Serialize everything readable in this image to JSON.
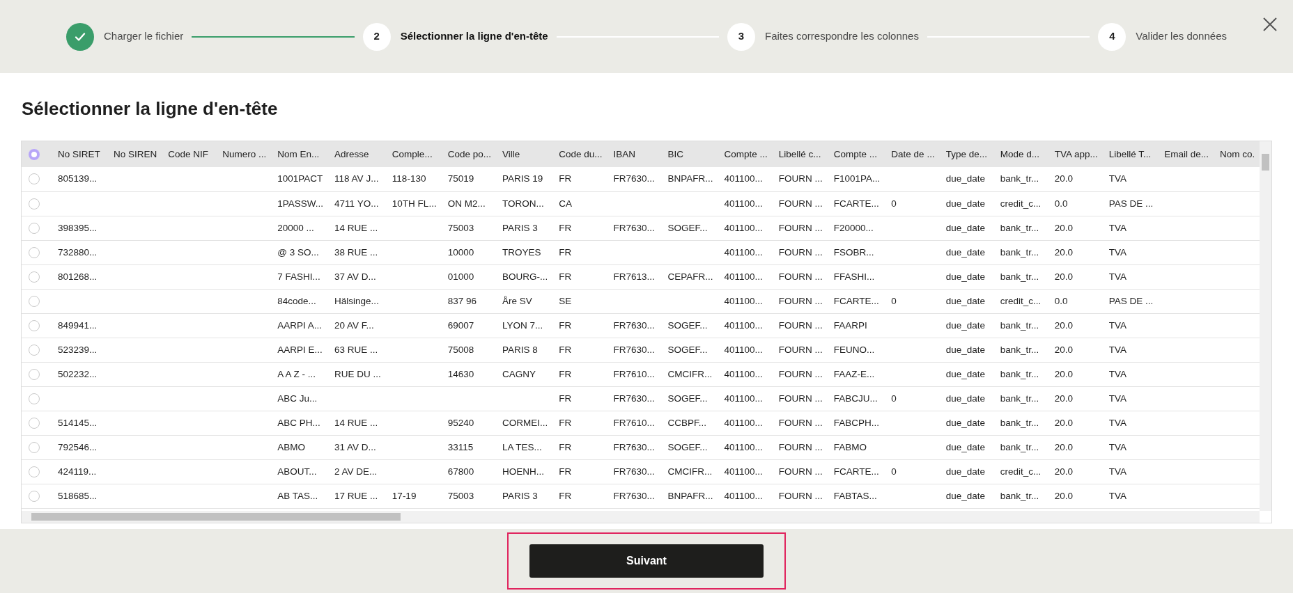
{
  "steps": [
    {
      "label": "Charger le fichier",
      "completed": true,
      "current": false
    },
    {
      "number": "2",
      "label": "Sélectionner la ligne d'en-tête",
      "completed": false,
      "current": true
    },
    {
      "number": "3",
      "label": "Faites correspondre les colonnes",
      "completed": false,
      "current": false
    },
    {
      "number": "4",
      "label": "Valider les données",
      "completed": false,
      "current": false
    }
  ],
  "title": "Sélectionner la ligne d'en-tête",
  "table": {
    "header_selected": true,
    "columns": [
      "No SIRET",
      "No SIREN",
      "Code NIF",
      "Numero ...",
      "Nom En...",
      "Adresse",
      "Comple...",
      "Code po...",
      "Ville",
      "Code du...",
      "IBAN",
      "BIC",
      "Compte ...",
      "Libellé c...",
      "Compte ...",
      "Date de ...",
      "Type de...",
      "Mode d...",
      "TVA app...",
      "Libellé T...",
      "Email de...",
      "Nom co."
    ],
    "rows": [
      {
        "selected": false,
        "cells": [
          "805139...",
          null,
          null,
          null,
          "1001PACT",
          "118 AV J...",
          "118-130",
          "75019",
          "PARIS 19",
          "FR",
          "FR7630...",
          "BNPAFR...",
          "401100...",
          "FOURN ...",
          "F1001PA...",
          null,
          "due_date",
          "bank_tr...",
          "20.0",
          "TVA",
          null,
          null
        ]
      },
      {
        "selected": false,
        "cells": [
          null,
          null,
          null,
          null,
          "1PASSW...",
          "4711 YO...",
          "10TH FL...",
          "ON M2...",
          "TORON...",
          "CA",
          null,
          null,
          "401100...",
          "FOURN ...",
          "FCARTE...",
          "0",
          "due_date",
          "credit_c...",
          "0.0",
          "PAS DE ...",
          null,
          null
        ]
      },
      {
        "selected": false,
        "cells": [
          "398395...",
          null,
          null,
          null,
          "20000 ...",
          "14 RUE ...",
          null,
          "75003",
          "PARIS 3",
          "FR",
          "FR7630...",
          "SOGEF...",
          "401100...",
          "FOURN ...",
          "F20000...",
          null,
          "due_date",
          "bank_tr...",
          "20.0",
          "TVA",
          null,
          null
        ]
      },
      {
        "selected": false,
        "cells": [
          "732880...",
          null,
          null,
          null,
          "@ 3 SO...",
          "38 RUE ...",
          null,
          "10000",
          "TROYES",
          "FR",
          null,
          null,
          "401100...",
          "FOURN ...",
          "FSOBR...",
          null,
          "due_date",
          "bank_tr...",
          "20.0",
          "TVA",
          null,
          null
        ]
      },
      {
        "selected": false,
        "cells": [
          "801268...",
          null,
          null,
          null,
          "7 FASHI...",
          "37 AV D...",
          null,
          "01000",
          "BOURG-...",
          "FR",
          "FR7613...",
          "CEPAFR...",
          "401100...",
          "FOURN ...",
          "FFASHI...",
          null,
          "due_date",
          "bank_tr...",
          "20.0",
          "TVA",
          null,
          null
        ]
      },
      {
        "selected": false,
        "cells": [
          null,
          null,
          null,
          null,
          "84code...",
          "Hälsinge...",
          null,
          "837 96",
          "Åre SV",
          "SE",
          null,
          null,
          "401100...",
          "FOURN ...",
          "FCARTE...",
          "0",
          "due_date",
          "credit_c...",
          "0.0",
          "PAS DE ...",
          null,
          null
        ]
      },
      {
        "selected": false,
        "cells": [
          "849941...",
          null,
          null,
          null,
          "AARPI A...",
          "20 AV F...",
          null,
          "69007",
          "LYON 7...",
          "FR",
          "FR7630...",
          "SOGEF...",
          "401100...",
          "FOURN ...",
          "FAARPI",
          null,
          "due_date",
          "bank_tr...",
          "20.0",
          "TVA",
          null,
          null
        ]
      },
      {
        "selected": false,
        "cells": [
          "523239...",
          null,
          null,
          null,
          "AARPI E...",
          "63 RUE ...",
          null,
          "75008",
          "PARIS 8",
          "FR",
          "FR7630...",
          "SOGEF...",
          "401100...",
          "FOURN ...",
          "FEUNO...",
          null,
          "due_date",
          "bank_tr...",
          "20.0",
          "TVA",
          null,
          null
        ]
      },
      {
        "selected": false,
        "cells": [
          "502232...",
          null,
          null,
          null,
          "A A Z - ...",
          "RUE DU ...",
          null,
          "14630",
          "CAGNY",
          "FR",
          "FR7610...",
          "CMCIFR...",
          "401100...",
          "FOURN ...",
          "FAAZ-E...",
          null,
          "due_date",
          "bank_tr...",
          "20.0",
          "TVA",
          null,
          null
        ]
      },
      {
        "selected": false,
        "cells": [
          null,
          null,
          null,
          null,
          "ABC Ju...",
          null,
          null,
          null,
          null,
          "FR",
          "FR7630...",
          "SOGEF...",
          "401100...",
          "FOURN ...",
          "FABCJU...",
          "0",
          "due_date",
          "bank_tr...",
          "20.0",
          "TVA",
          null,
          null
        ]
      },
      {
        "selected": false,
        "cells": [
          "514145...",
          null,
          null,
          null,
          "ABC PH...",
          "14 RUE ...",
          null,
          "95240",
          "CORMEI...",
          "FR",
          "FR7610...",
          "CCBPF...",
          "401100...",
          "FOURN ...",
          "FABCPH...",
          null,
          "due_date",
          "bank_tr...",
          "20.0",
          "TVA",
          null,
          null
        ]
      },
      {
        "selected": false,
        "cells": [
          "792546...",
          null,
          null,
          null,
          "ABMO",
          "31 AV D...",
          null,
          "33115",
          "LA TES...",
          "FR",
          "FR7630...",
          "SOGEF...",
          "401100...",
          "FOURN ...",
          "FABMO",
          null,
          "due_date",
          "bank_tr...",
          "20.0",
          "TVA",
          null,
          null
        ]
      },
      {
        "selected": false,
        "cells": [
          "424119...",
          null,
          null,
          null,
          "ABOUT...",
          "2 AV DE...",
          null,
          "67800",
          "HOENH...",
          "FR",
          "FR7630...",
          "CMCIFR...",
          "401100...",
          "FOURN ...",
          "FCARTE...",
          "0",
          "due_date",
          "credit_c...",
          "20.0",
          "TVA",
          null,
          null
        ]
      },
      {
        "selected": false,
        "cells": [
          "518685...",
          null,
          null,
          null,
          "AB TAS...",
          "17 RUE ...",
          "17-19",
          "75003",
          "PARIS 3",
          "FR",
          "FR7630...",
          "BNPAFR...",
          "401100...",
          "FOURN ...",
          "FABTAS...",
          null,
          "due_date",
          "bank_tr...",
          "20.0",
          "TVA",
          null,
          null
        ]
      }
    ]
  },
  "next_button": "Suivant"
}
